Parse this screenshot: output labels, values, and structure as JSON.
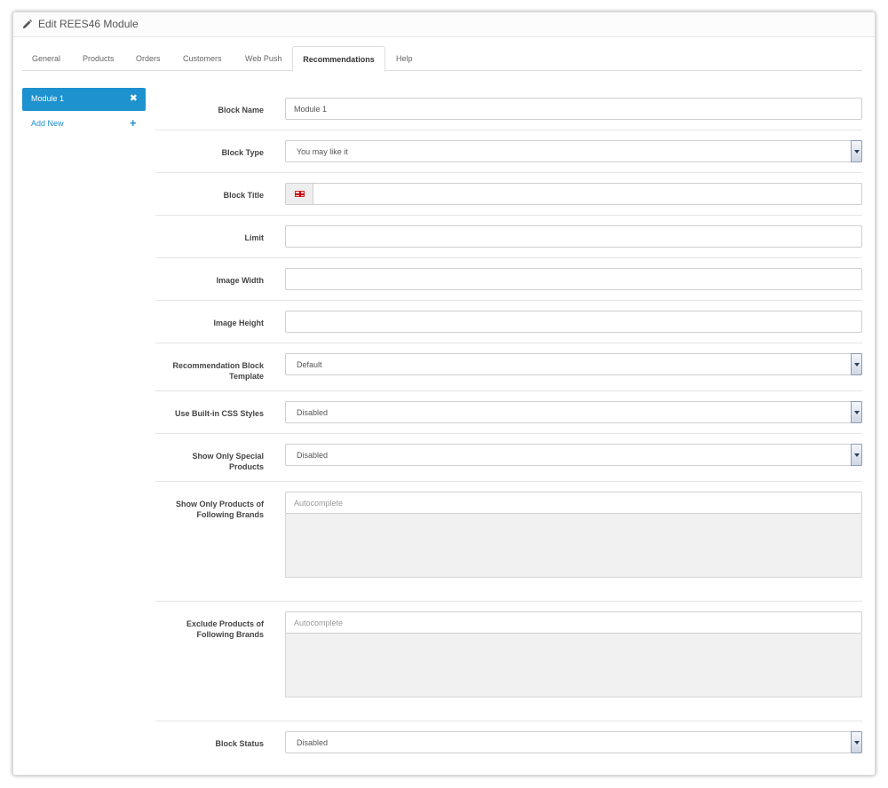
{
  "header": {
    "title": "Edit REES46 Module",
    "icon": "pencil-icon"
  },
  "tabs": [
    {
      "label": "General"
    },
    {
      "label": "Products"
    },
    {
      "label": "Orders"
    },
    {
      "label": "Customers"
    },
    {
      "label": "Web Push"
    },
    {
      "label": "Recommendations",
      "active": true
    },
    {
      "label": "Help"
    }
  ],
  "sidebar": {
    "active_module": "Module 1",
    "remove_glyph": "✖",
    "add_new": "Add New",
    "add_glyph": "+"
  },
  "accent_color": "#1e91cf",
  "form": {
    "block_name": {
      "label": "Block Name",
      "value": "Module 1"
    },
    "block_type": {
      "label": "Block Type",
      "value": "You may like it"
    },
    "block_title": {
      "label": "Block Title",
      "value": "",
      "flag_icon": "uk-flag-icon"
    },
    "limit": {
      "label": "Limit",
      "value": ""
    },
    "image_width": {
      "label": "Image Width",
      "value": ""
    },
    "image_height": {
      "label": "Image Height",
      "value": ""
    },
    "template": {
      "label": "Recommendation Block Template",
      "value": "Default"
    },
    "css_styles": {
      "label": "Use Built-in CSS Styles",
      "value": "Disabled"
    },
    "special_products": {
      "label": "Show Only Special Products",
      "value": "Disabled"
    },
    "include_brands": {
      "label": "Show Only Products of Following Brands",
      "placeholder": "Autocomplete"
    },
    "exclude_brands": {
      "label": "Exclude Products of Following Brands",
      "placeholder": "Autocomplete"
    },
    "block_status": {
      "label": "Block Status",
      "value": "Disabled"
    }
  }
}
